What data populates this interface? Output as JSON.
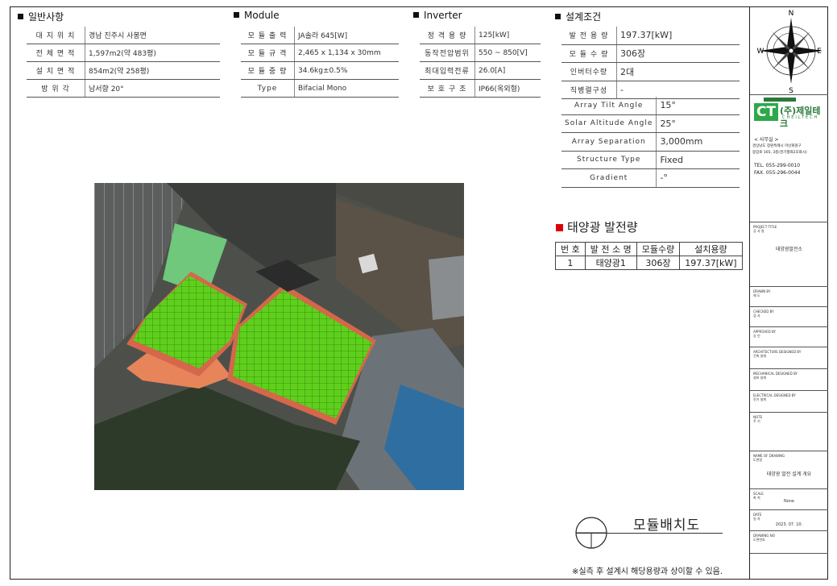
{
  "general": {
    "title": "일반사항",
    "rows": [
      {
        "k": "대 지 위 치",
        "v": "경남 진주시 사봉면"
      },
      {
        "k": "전 체 면 적",
        "v": "1,597m2(약 483평)"
      },
      {
        "k": "설 치 면 적",
        "v": "854m2(약 258평)"
      },
      {
        "k": "방  위  각",
        "v": "남서향 20°"
      }
    ]
  },
  "module": {
    "title": "Module",
    "rows": [
      {
        "k": "모 듈 출 력",
        "v": "JA솔라 645[W]"
      },
      {
        "k": "모 듈 규 격",
        "v": "2,465 x 1,134 x 30mm"
      },
      {
        "k": "모 듈 중 량",
        "v": "34.6kg±0.5%"
      },
      {
        "k": "Type",
        "v": "Bifacial Mono"
      }
    ]
  },
  "inverter": {
    "title": "Inverter",
    "rows": [
      {
        "k": "정 격 용 량",
        "v": "125[kW]"
      },
      {
        "k": "동작전압범위",
        "v": "550 ~ 850[V]"
      },
      {
        "k": "최대입력전류",
        "v": "26.0[A]"
      },
      {
        "k": "보 호 구 조",
        "v": "IP66(옥외형)"
      }
    ]
  },
  "conditions": {
    "title": "설계조건",
    "rows": [
      {
        "k": "발 전 용 량",
        "v": "197.37[kW]"
      },
      {
        "k": "모 듈 수 량",
        "v": "306장"
      },
      {
        "k": "인버터수량",
        "v": "2대"
      },
      {
        "k": "직병렬구성",
        "v": "-"
      }
    ],
    "extra": [
      {
        "k": "Array Tilt Angle",
        "v": "15°"
      },
      {
        "k": "Solar Altitude Angle",
        "v": "25°"
      },
      {
        "k": "Array Separation",
        "v": "3,000mm"
      },
      {
        "k": "Structure Type",
        "v": "Fixed"
      },
      {
        "k": "Gradient",
        "v": "-°"
      }
    ]
  },
  "generation": {
    "title": "태양광 발전량",
    "headers": [
      "번 호",
      "발 전 소 명",
      "모듈수량",
      "설치용량"
    ],
    "rows": [
      [
        "1",
        "태양광1",
        "306장",
        "197.37[kW]"
      ]
    ]
  },
  "compass": {
    "n": "N",
    "s": "S",
    "e": "E",
    "w": "W"
  },
  "company": {
    "logo_mark": "CT",
    "name": "(주)제일테크",
    "name_en": "CHEILTECH",
    "badge": "",
    "office_label": "< 사무실 >",
    "address_1": "경상남도 창원특례시 마산회원구",
    "address_2": "봉암로 165, 3층(경기평화2호화시)",
    "tel": "TEL. 055-299-0010",
    "fax": "FAX. 055-296-0044"
  },
  "title_block": {
    "project_label": "PROJECT TITLE\n공 사 명",
    "project_value": "태양광발전소",
    "drawn_label": "DRAWN BY\n제 도",
    "checked_label": "CHECKED BY\n검 사",
    "approved_label": "APPROVED BY\n승 인",
    "arch_label": "ARCHITECTURE DESIGNED BY\n건축 설계",
    "mech_label": "MECHANICAL DESIGNED BY\n설비 설계",
    "elec_label": "ELECTRICAL DESIGNED BY\n전기 설계",
    "note_label": "NOTE\n주 기",
    "drawing_label": "NAME OF DRAWING\n도면명",
    "drawing_value": "태양광 발전 설계 개요",
    "scale_label": "SCALE\n축 척",
    "scale_value": "None",
    "date_label": "DATE\n일 자",
    "date_value": "2023. 07. 10.",
    "number_label": "DRAWING NO\n도면번호"
  },
  "bottom": {
    "title": "모듈배치도",
    "note": "※실측 후 설계시 해당용량과 상이할 수 있음."
  }
}
